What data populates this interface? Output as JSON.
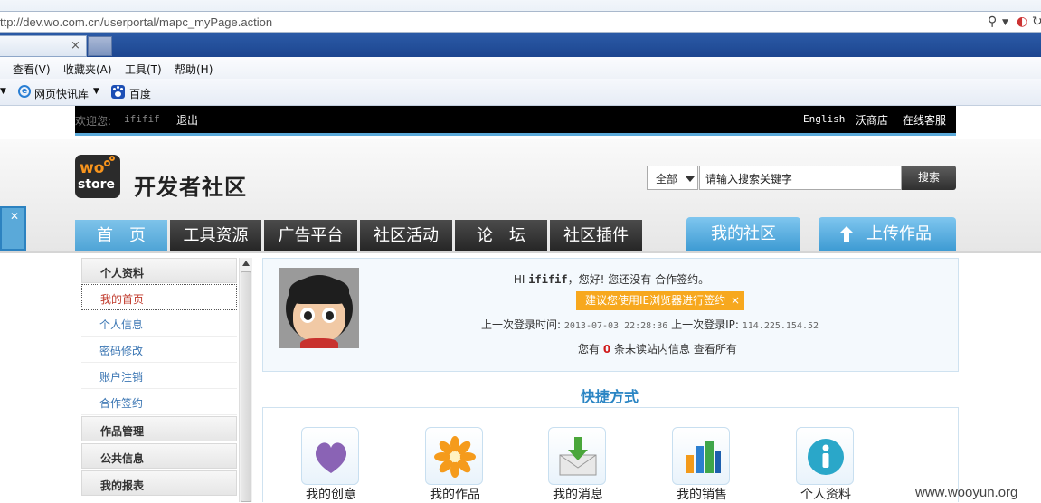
{
  "browser": {
    "url": "ttp://dev.wo.com.cn/userportal/mapc_myPage.action",
    "tab_close": "×",
    "menu": [
      "查看(V)",
      "收藏夹(A)",
      "工具(T)",
      "帮助(H)"
    ],
    "favorites": [
      "网页快讯库",
      "百度"
    ]
  },
  "topbar": {
    "welcome_label": "欢迎您:",
    "username": "ififif",
    "logout": "退出",
    "right_links": [
      "English",
      "沃商店",
      "在线客服"
    ]
  },
  "header": {
    "site_title": "开发者社区",
    "logo_text_top": "wo",
    "logo_text_bottom": "store",
    "search": {
      "scope": "全部",
      "placeholder": "请输入搜索关键字",
      "button": "搜索"
    },
    "nav": [
      "首　页",
      "工具资源",
      "广告平台",
      "社区活动",
      "论　坛",
      "社区插件"
    ],
    "nav_right": [
      "我的社区",
      "上传作品"
    ],
    "active_index": 0
  },
  "sidebar": {
    "sections": [
      {
        "title": "个人资料",
        "items": [
          "我的首页",
          "个人信息",
          "密码修改",
          "账户注销",
          "合作签约"
        ]
      },
      {
        "title": "作品管理",
        "items": []
      },
      {
        "title": "公共信息",
        "items": []
      },
      {
        "title": "我的报表",
        "items": []
      }
    ],
    "current_item": "我的首页"
  },
  "profile": {
    "hi_prefix": "HI",
    "username": "ififif",
    "hi_suffix": "，您好!  您还没有 合作签约。",
    "ie_notice": "建议您使用IE浏览器进行签约",
    "ie_notice_close": "×",
    "last_login_time_label": "上一次登录时间:",
    "last_login_time": "2013-07-03 22:28:36",
    "last_login_ip_label": "上一次登录IP:",
    "last_login_ip": "114.225.154.52",
    "msg_prefix": "您有",
    "msg_count": "0",
    "msg_suffix": "条未读站内信息",
    "view_all": "查看所有"
  },
  "quick": {
    "title": "快捷方式",
    "items": [
      {
        "label": "我的创意",
        "icon": "heart-icon"
      },
      {
        "label": "我的作品",
        "icon": "flower-icon"
      },
      {
        "label": "我的消息",
        "icon": "inbox-download-icon"
      },
      {
        "label": "我的销售",
        "icon": "bar-chart-icon"
      },
      {
        "label": "个人资料",
        "icon": "info-icon"
      }
    ]
  },
  "watermark": "www.wooyun.org",
  "colors": {
    "accent": "#4fa4d6",
    "topbar": "#000000",
    "notice": "#f7a81e",
    "link": "#3b76b3"
  }
}
